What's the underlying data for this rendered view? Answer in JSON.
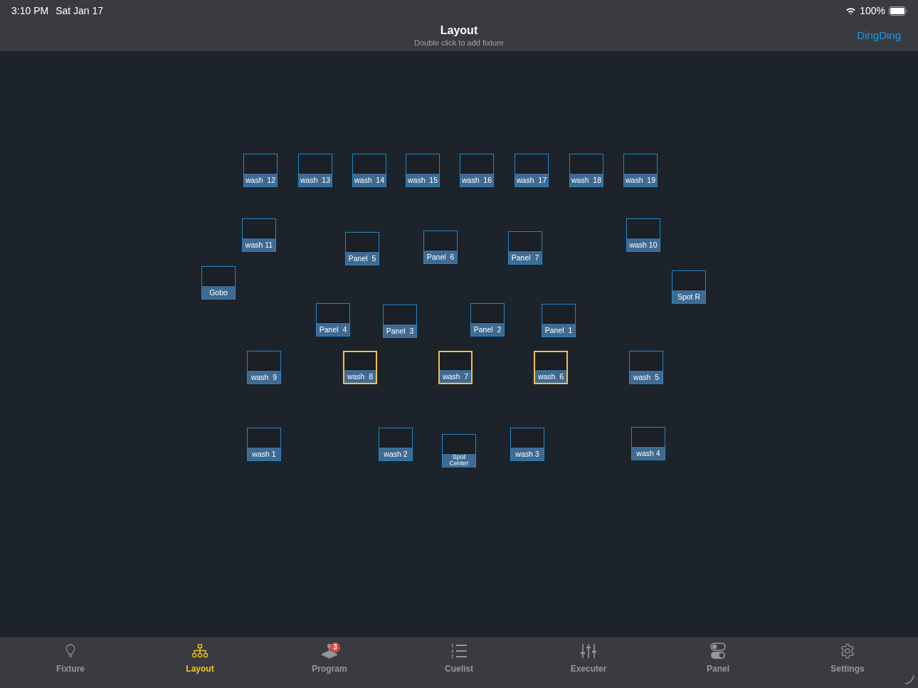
{
  "status_bar": {
    "time": "3:10 PM",
    "date": "Sat Jan 17",
    "battery": "100%"
  },
  "nav_bar": {
    "title": "Layout",
    "subtitle": "Double click to add fixture",
    "action": "DingDing"
  },
  "fixtures": [
    {
      "label": "wash  12",
      "selected": false
    },
    {
      "label": "wash  13",
      "selected": false
    },
    {
      "label": "wash  14",
      "selected": false
    },
    {
      "label": "wash  15",
      "selected": false
    },
    {
      "label": "wash  16",
      "selected": false
    },
    {
      "label": "wash  17",
      "selected": false
    },
    {
      "label": "wash  18",
      "selected": false
    },
    {
      "label": "wash  19",
      "selected": false
    },
    {
      "label": "wash 11",
      "selected": false
    },
    {
      "label": "Panel  5",
      "selected": false
    },
    {
      "label": "Panel  6",
      "selected": false
    },
    {
      "label": "Panel  7",
      "selected": false
    },
    {
      "label": "wash 10",
      "selected": false
    },
    {
      "label": "Gobo",
      "selected": false
    },
    {
      "label": "Spot R",
      "selected": false
    },
    {
      "label": "Panel  4",
      "selected": false
    },
    {
      "label": "Panel  3",
      "selected": false
    },
    {
      "label": "Panel  2",
      "selected": false
    },
    {
      "label": "Panel  1",
      "selected": false
    },
    {
      "label": "wash  9",
      "selected": false
    },
    {
      "label": "wash  8",
      "selected": true
    },
    {
      "label": "wash  7",
      "selected": true
    },
    {
      "label": "wash  6",
      "selected": true
    },
    {
      "label": "wash  5",
      "selected": false
    },
    {
      "label": "wash 1",
      "selected": false
    },
    {
      "label": "wash 2",
      "selected": false
    },
    {
      "label": "Spot Center",
      "selected": false
    },
    {
      "label": "wash 3",
      "selected": false
    },
    {
      "label": "wash 4",
      "selected": false
    }
  ],
  "tabs": [
    {
      "label": "Fixture",
      "selected": false
    },
    {
      "label": "Layout",
      "selected": true
    },
    {
      "label": "Program",
      "selected": false,
      "badge": "3"
    },
    {
      "label": "Cuelist",
      "selected": false
    },
    {
      "label": "Executer",
      "selected": false
    },
    {
      "label": "Panel",
      "selected": false
    },
    {
      "label": "Settings",
      "selected": false
    }
  ]
}
